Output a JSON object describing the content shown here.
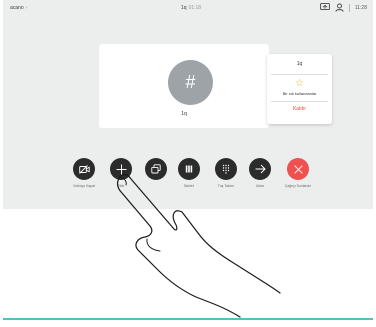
{
  "topbar": {
    "brand": "acano",
    "brand_chevron": "›",
    "call_name": "1q",
    "call_duration": "01:18",
    "clock": "11:28",
    "icons": [
      "screen-share-icon",
      "user-icon"
    ]
  },
  "participant_card": {
    "avatar_symbol": "#",
    "name": "1q"
  },
  "context_menu": {
    "name": "1q",
    "favorite_label": "Bir sık kullanılanlar",
    "remove_label": "Kaldır"
  },
  "controls": [
    {
      "id": "video-off",
      "label": "Videoyu Kapat",
      "icon": "video-off-icon"
    },
    {
      "id": "add",
      "label": "Ekle",
      "icon": "plus-icon"
    },
    {
      "id": "share",
      "label": "",
      "icon": "share-icon"
    },
    {
      "id": "hold",
      "label": "Beklet",
      "icon": "pause-icon"
    },
    {
      "id": "keypad",
      "label": "Tuş Takımı",
      "icon": "keypad-icon"
    },
    {
      "id": "transfer",
      "label": "Aktar",
      "icon": "arrow-right-icon"
    },
    {
      "id": "end",
      "label": "Çağrıyı Sonlandır",
      "icon": "close-icon"
    }
  ],
  "colors": {
    "screen_bg": "#eceded",
    "button_dark": "#2b2b2b",
    "end_call": "#ef5150",
    "avatar": "#9ea3a7",
    "star": "#f2b81e",
    "remove_text": "#e2513f",
    "divider": "#57c0b8"
  }
}
